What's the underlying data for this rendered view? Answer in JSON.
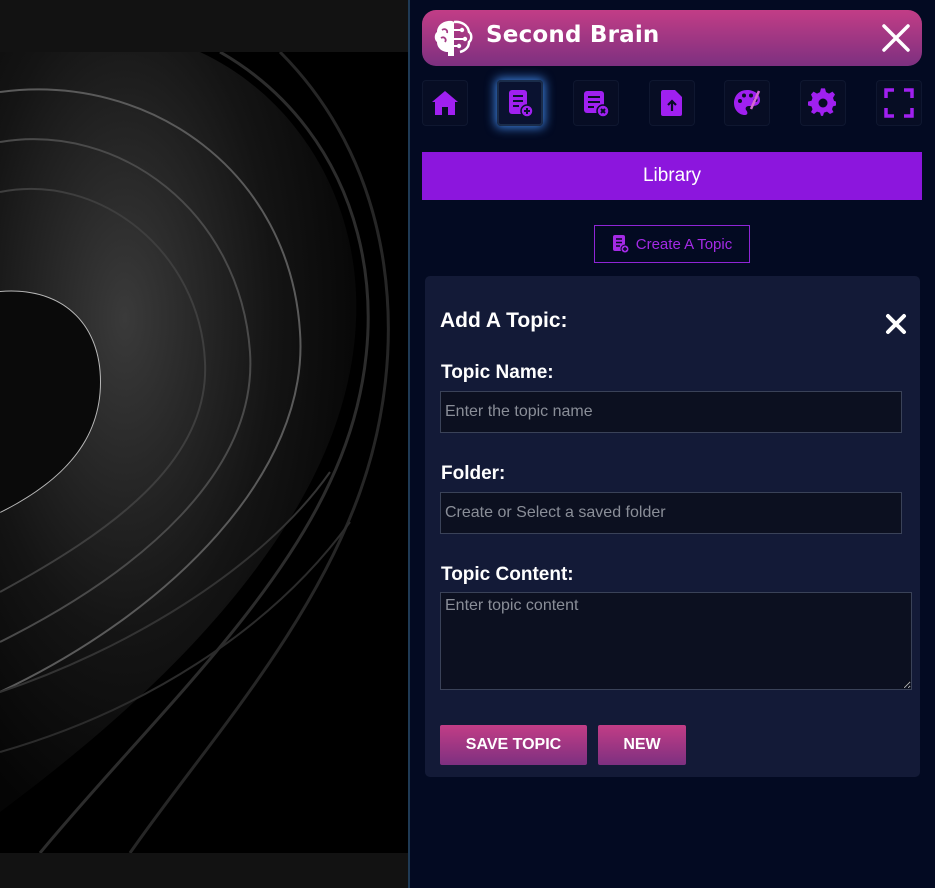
{
  "app": {
    "title": "Second Brain",
    "logo_icon": "brain-circuit-icon",
    "close_icon": "close-icon"
  },
  "toolbar": {
    "items": [
      {
        "name": "home",
        "icon": "home-icon",
        "active": false
      },
      {
        "name": "create-topic",
        "icon": "document-add-icon",
        "active": true
      },
      {
        "name": "topic-list",
        "icon": "list-add-icon",
        "active": false
      },
      {
        "name": "upload",
        "icon": "file-upload-icon",
        "active": false
      },
      {
        "name": "theme",
        "icon": "palette-icon",
        "active": false
      },
      {
        "name": "settings",
        "icon": "gear-icon",
        "active": false
      },
      {
        "name": "fullscreen",
        "icon": "fullscreen-icon",
        "active": false
      }
    ]
  },
  "section": {
    "title": "Library"
  },
  "create_button": {
    "label": "Create A Topic",
    "icon": "document-add-icon"
  },
  "form": {
    "heading": "Add A Topic:",
    "topic_name": {
      "label": "Topic Name:",
      "placeholder": "Enter the topic name",
      "value": ""
    },
    "folder": {
      "label": "Folder:",
      "placeholder": "Create or Select a saved folder",
      "value": ""
    },
    "content": {
      "label": "Topic Content:",
      "placeholder": "Enter topic content",
      "value": ""
    },
    "save_label": "SAVE TOPIC",
    "new_label": "NEW"
  },
  "colors": {
    "accent_purple": "#8c16dd",
    "icon_purple": "#a020f0",
    "header_gradient_top": "#c23d86",
    "header_gradient_bottom": "#7d3080",
    "panel_bg": "#030a22",
    "card_bg": "#131a37"
  }
}
